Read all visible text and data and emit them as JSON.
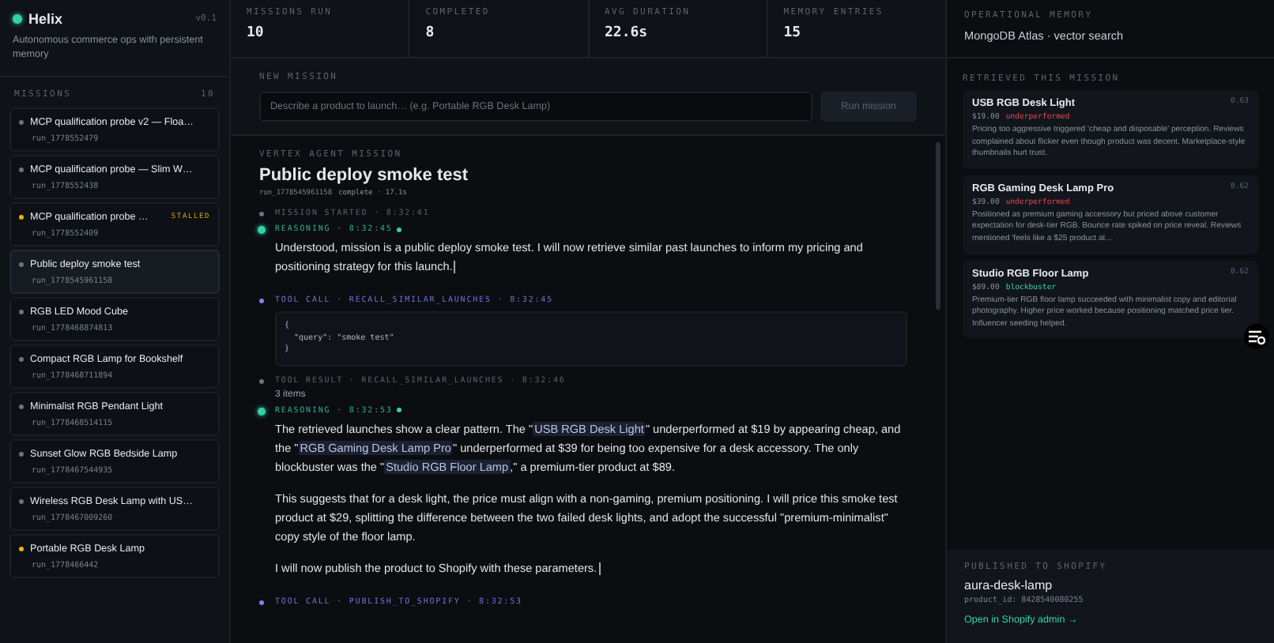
{
  "app": {
    "name": "Helix",
    "version": "v0.1",
    "tagline": "Autonomous commerce ops with persistent memory"
  },
  "missions": {
    "label": "MISSIONS",
    "count": "10",
    "items": [
      {
        "title": "MCP qualification probe v2 — Floa…",
        "run": "run_1778552479",
        "color": "#6b7280",
        "selected": false
      },
      {
        "title": "MCP qualification probe — Slim W…",
        "run": "run_1778552438",
        "color": "#6b7280",
        "selected": false
      },
      {
        "title": "MCP qualification probe …",
        "run": "run_1778552409",
        "color": "#eab308",
        "badge": "STALLED",
        "selected": false
      },
      {
        "title": "Public deploy smoke test",
        "run": "run_1778545961158",
        "color": "#6b7280",
        "selected": true
      },
      {
        "title": "RGB LED Mood Cube",
        "run": "run_1778468874813",
        "color": "#6b7280",
        "selected": false
      },
      {
        "title": "Compact RGB Lamp for Bookshelf",
        "run": "run_1778468711894",
        "color": "#6b7280",
        "selected": false
      },
      {
        "title": "Minimalist RGB Pendant Light",
        "run": "run_1778468514115",
        "color": "#6b7280",
        "selected": false
      },
      {
        "title": "Sunset Glow RGB Bedside Lamp",
        "run": "run_1778467544935",
        "color": "#6b7280",
        "selected": false
      },
      {
        "title": "Wireless RGB Desk Lamp with US…",
        "run": "run_1778467009260",
        "color": "#6b7280",
        "selected": false
      },
      {
        "title": "Portable RGB Desk Lamp",
        "run": "run_1778466442",
        "color": "#eab308",
        "selected": false
      }
    ]
  },
  "stats": [
    {
      "label": "MISSIONS RUN",
      "value": "10"
    },
    {
      "label": "COMPLETED",
      "value": "8"
    },
    {
      "label": "AVG DURATION",
      "value": "22.6s"
    },
    {
      "label": "MEMORY ENTRIES",
      "value": "15"
    }
  ],
  "new_mission": {
    "label": "NEW MISSION",
    "placeholder": "Describe a product to launch… (e.g. Portable RGB Desk Lamp)",
    "button": "Run mission",
    "button_disabled": true
  },
  "mission": {
    "label": "VERTEX AGENT MISSION",
    "title": "Public deploy smoke test",
    "run": "run_1778545961158",
    "meta": "complete · 17.1s",
    "events": [
      {
        "kind": "started",
        "header": "MISSION STARTED · 8:32:41"
      },
      {
        "kind": "reasoning",
        "header": "REASONING · 8:32:45",
        "live": true,
        "cursor": true,
        "paragraphs": [
          [
            {
              "kind": "text",
              "text": "Understood, mission is a public deploy smoke test. I will now retrieve similar past launches to inform my pricing and positioning strategy for this launch."
            }
          ]
        ]
      },
      {
        "kind": "tool_call",
        "header": "TOOL CALL · RECALL_SIMILAR_LAUNCHES · 8:32:45",
        "code": "{\n  \"query\": \"smoke test\"\n}"
      },
      {
        "kind": "tool_result",
        "header": "TOOL RESULT · RECALL_SIMILAR_LAUNCHES · 8:32:46",
        "summary": "3 items"
      },
      {
        "kind": "reasoning",
        "header": "REASONING · 8:32:53",
        "live": true,
        "cursor": true,
        "paragraphs": [
          [
            {
              "kind": "text",
              "text": "The retrieved launches show a clear pattern. The \""
            },
            {
              "kind": "reference",
              "text": "USB RGB Desk Light"
            },
            {
              "kind": "text",
              "text": "\" underperformed at $19 by appearing cheap, and the \""
            },
            {
              "kind": "reference",
              "text": "RGB Gaming Desk Lamp Pro"
            },
            {
              "kind": "text",
              "text": "\" underperformed at $39 for being too expensive for a desk accessory. The only blockbuster was the \""
            },
            {
              "kind": "reference",
              "text": "Studio RGB Floor Lamp"
            },
            {
              "kind": "text",
              "text": ",\" a premium-tier product at $89."
            }
          ],
          [
            {
              "kind": "text",
              "text": "This suggests that for a desk light, the price must align with a non-gaming, premium positioning. I will price this smoke test product at $29, splitting the difference between the two failed desk lights, and adopt the successful \"premium-minimalist\" copy style of the floor lamp."
            }
          ],
          [
            {
              "kind": "text",
              "text": "I will now publish the product to Shopify with these parameters."
            }
          ]
        ]
      },
      {
        "kind": "tool_call",
        "header": "TOOL CALL · PUBLISH_TO_SHOPIFY · 8:32:53"
      }
    ]
  },
  "memory": {
    "label": "OPERATIONAL MEMORY",
    "source": "MongoDB Atlas · vector search",
    "retrieved_label": "RETRIEVED THIS MISSION",
    "items": [
      {
        "title": "USB RGB Desk Light",
        "score": "0.63",
        "price": "$19.00",
        "outcome": "underperformed",
        "text": "Pricing too aggressive triggered 'cheap and disposable' perception. Reviews complained about flicker even though product was decent. Marketplace-style thumbnails hurt trust."
      },
      {
        "title": "RGB Gaming Desk Lamp Pro",
        "score": "0.62",
        "price": "$39.00",
        "outcome": "underperformed",
        "text": "Positioned as premium gaming accessory but priced above customer expectation for desk-tier RGB. Bounce rate spiked on price reveal. Reviews mentioned 'feels like a $25 product at…"
      },
      {
        "title": "Studio RGB Floor Lamp",
        "score": "0.62",
        "price": "$89.00",
        "outcome": "blockbuster",
        "text": "Premium-tier RGB floor lamp succeeded with minimalist copy and editorial photography. Higher price worked because positioning matched price tier. Influencer seeding helped."
      }
    ]
  },
  "published": {
    "label": "PUBLISHED TO SHOPIFY",
    "handle": "aura-desk-lamp",
    "product_id": "product_id: 8428540080255",
    "link": "Open in Shopify admin →"
  }
}
